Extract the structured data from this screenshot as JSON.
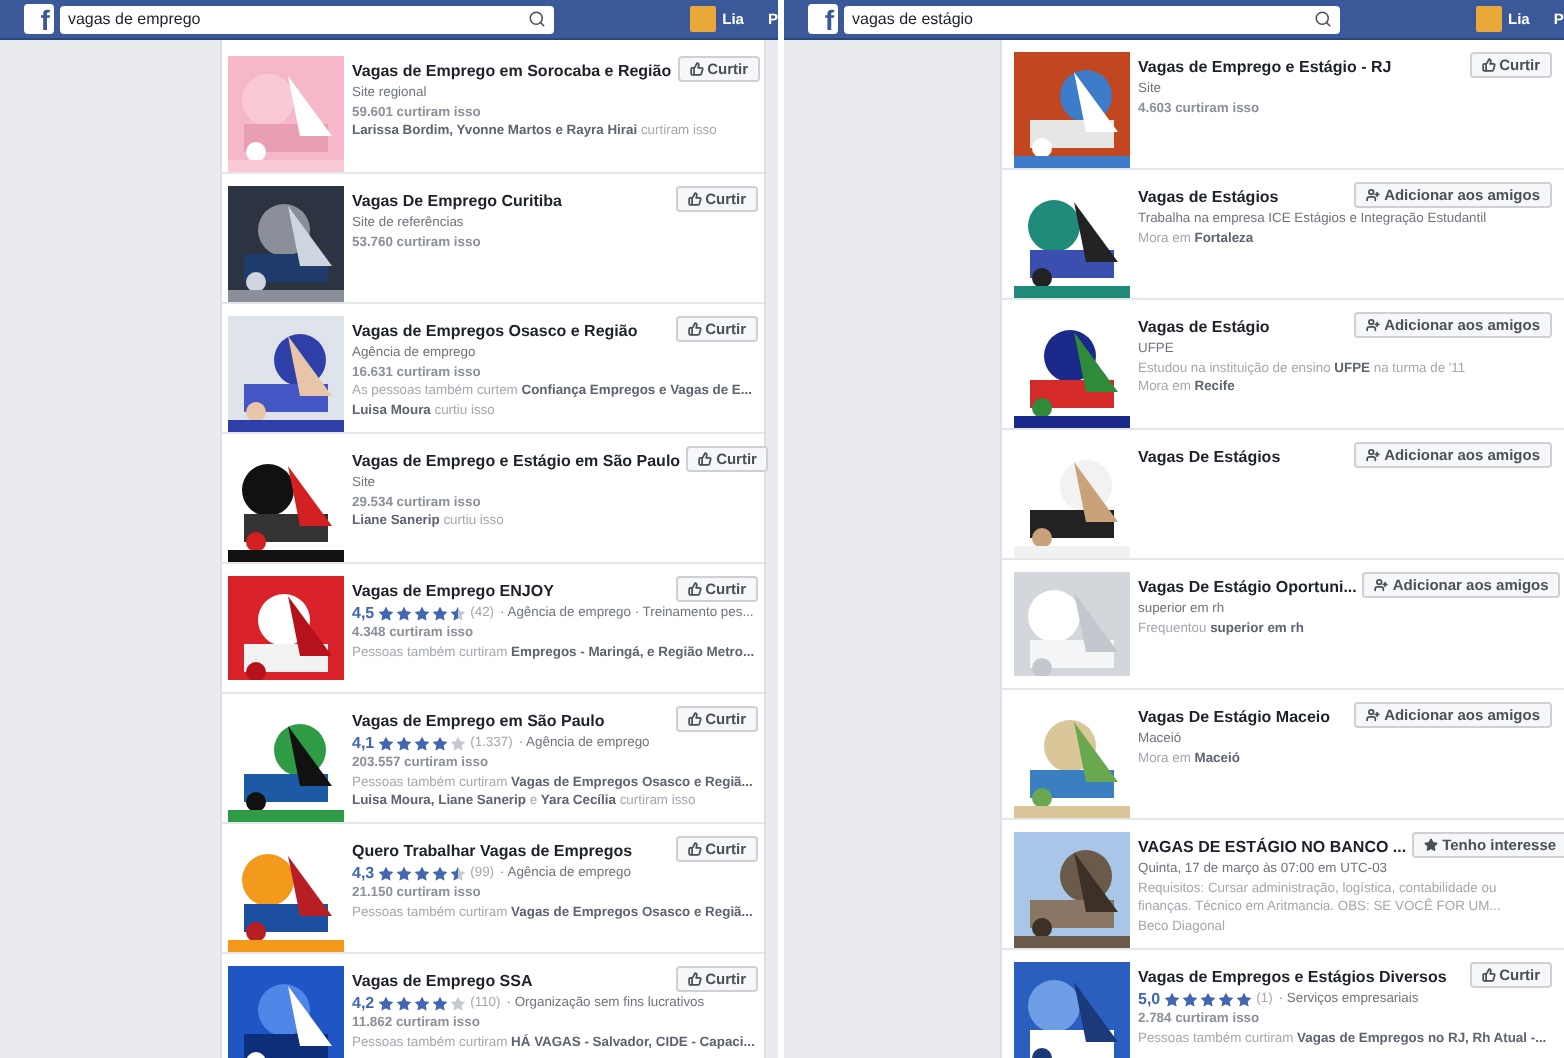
{
  "panels": [
    {
      "header": {
        "logo": "f",
        "search": {
          "value": "vagas de emprego"
        },
        "user": "Lia",
        "cut_label": "P"
      },
      "results": [
        {
          "title": "Vagas de Emprego em Sorocaba e Região",
          "button": {
            "kind": "like",
            "label": "Curtir"
          },
          "lines": [
            {
              "kind": "plain",
              "text": "Site regional"
            },
            {
              "kind": "count",
              "text": "59.601 curtiram isso"
            },
            {
              "kind": "muted",
              "text": "**Larissa Bordim, Yvonne Martos e Rayra Hirai** curtiram isso"
            }
          ]
        },
        {
          "title": "Vagas De Emprego Curitiba",
          "button": {
            "kind": "like",
            "label": "Curtir"
          },
          "lines": [
            {
              "kind": "plain",
              "text": "Site de referências"
            },
            {
              "kind": "count",
              "text": "53.760 curtiram isso"
            }
          ]
        },
        {
          "title": "Vagas de Empregos Osasco e Região",
          "button": {
            "kind": "like",
            "label": "Curtir"
          },
          "lines": [
            {
              "kind": "plain",
              "text": "Agência de emprego"
            },
            {
              "kind": "count",
              "text": "16.631 curtiram isso"
            },
            {
              "kind": "muted",
              "text": "As pessoas também curtem **Confiança Empregos e Vagas de E...**"
            },
            {
              "kind": "muted",
              "text": "**Luisa Moura** curtiu isso"
            }
          ]
        },
        {
          "title": "Vagas de Emprego e Estágio em São Paulo",
          "button": {
            "kind": "like",
            "label": "Curtir"
          },
          "lines": [
            {
              "kind": "plain",
              "text": "Site"
            },
            {
              "kind": "count",
              "text": "29.534 curtiram isso"
            },
            {
              "kind": "muted",
              "text": "**Liane Sanerip** curtiu isso"
            }
          ]
        },
        {
          "title": "Vagas de Emprego ENJOY",
          "button": {
            "kind": "like",
            "label": "Curtir"
          },
          "lines": [
            {
              "kind": "rating",
              "score": "4,5",
              "stars": 4.5,
              "count": "(42)",
              "text": "· Agência de emprego · Treinamento pes..."
            },
            {
              "kind": "count",
              "text": "4.348 curtiram isso"
            },
            {
              "kind": "muted",
              "text": "Pessoas também curtiram **Empregos - Maringá, e Região Metro...**"
            }
          ]
        },
        {
          "title": "Vagas de Emprego em São Paulo",
          "button": {
            "kind": "like",
            "label": "Curtir"
          },
          "lines": [
            {
              "kind": "rating",
              "score": "4,1",
              "stars": 4,
              "count": "(1.337)",
              "text": "· Agência de emprego"
            },
            {
              "kind": "count",
              "text": "203.557 curtiram isso"
            },
            {
              "kind": "muted",
              "text": "Pessoas também curtiram **Vagas de Empregos Osasco e Regiã...**"
            },
            {
              "kind": "muted",
              "text": "**Luisa Moura, Liane Sanerip** e **Yara Cecília** curtiram isso"
            }
          ]
        },
        {
          "title": "Quero Trabalhar Vagas de Empregos",
          "button": {
            "kind": "like",
            "label": "Curtir"
          },
          "lines": [
            {
              "kind": "rating",
              "score": "4,3",
              "stars": 4.5,
              "count": "(99)",
              "text": "· Agência de emprego"
            },
            {
              "kind": "count",
              "text": "21.150 curtiram isso"
            },
            {
              "kind": "muted",
              "text": "Pessoas também curtiram **Vagas de Empregos Osasco e Regiã...**"
            }
          ]
        },
        {
          "title": "Vagas de Emprego SSA",
          "button": {
            "kind": "like",
            "label": "Curtir"
          },
          "lines": [
            {
              "kind": "rating",
              "score": "4,2",
              "stars": 4,
              "count": "(110)",
              "text": "· Organização sem fins lucrativos"
            },
            {
              "kind": "count",
              "text": "11.862 curtiram isso"
            },
            {
              "kind": "muted",
              "text": "Pessoas também curtiram **HÁ VAGAS - Salvador, CIDE - Capaci...**"
            }
          ]
        }
      ]
    },
    {
      "header": {
        "logo": "f",
        "search": {
          "value": "vagas de estágio"
        },
        "user": "Lia",
        "cut_label": "P"
      },
      "results": [
        {
          "title": "Vagas de Emprego e Estágio - RJ",
          "button": {
            "kind": "like",
            "label": "Curtir"
          },
          "lines": [
            {
              "kind": "plain",
              "text": "Site"
            },
            {
              "kind": "count",
              "text": "4.603 curtiram isso"
            }
          ]
        },
        {
          "title": "Vagas de Estágios",
          "button": {
            "kind": "add_friend",
            "label": "Adicionar aos amigos"
          },
          "lines": [
            {
              "kind": "plain",
              "text": "Trabalha na empresa ICE Estágios e Integração Estudantil"
            },
            {
              "kind": "muted",
              "text": "Mora em **Fortaleza**"
            }
          ]
        },
        {
          "title": "Vagas de Estágio",
          "button": {
            "kind": "add_friend",
            "label": "Adicionar aos amigos"
          },
          "lines": [
            {
              "kind": "plain",
              "text": "UFPE"
            },
            {
              "kind": "muted",
              "text": "Estudou na instituição de ensino **UFPE** na turma de '11"
            },
            {
              "kind": "muted",
              "text": "Mora em **Recife**"
            }
          ]
        },
        {
          "title": "Vagas De Estágios",
          "button": {
            "kind": "add_friend",
            "label": "Adicionar aos amigos"
          }
        },
        {
          "title": "Vagas De Estágio Oportuni...",
          "button": {
            "kind": "add_friend",
            "label": "Adicionar aos amigos"
          },
          "lines": [
            {
              "kind": "plain",
              "text": "superior em rh"
            },
            {
              "kind": "muted",
              "text": "Frequentou **superior em rh**"
            }
          ]
        },
        {
          "title": "Vagas De Estágio Maceio",
          "button": {
            "kind": "add_friend",
            "label": "Adicionar aos amigos"
          },
          "lines": [
            {
              "kind": "plain",
              "text": "Maceió"
            },
            {
              "kind": "muted",
              "text": "Mora em **Maceió**"
            }
          ]
        },
        {
          "title": "VAGAS DE ESTÁGIO NO BANCO ...",
          "button": {
            "kind": "interest",
            "label": "Tenho interesse"
          },
          "lines": [
            {
              "kind": "plain",
              "text": "Quinta, 17 de março às 07:00 em UTC-03"
            },
            {
              "kind": "muted",
              "text": "Requisitos: Cursar administração, logística, contabilidade ou finanças. Técnico em Aritmancia. OBS: SE VOCÊ FOR UM..."
            },
            {
              "kind": "muted",
              "text": "Beco Diagonal"
            }
          ]
        },
        {
          "title": "Vagas de Empregos e Estágios Diversos",
          "button": {
            "kind": "like",
            "label": "Curtir"
          },
          "lines": [
            {
              "kind": "rating",
              "score": "5,0",
              "stars": 5,
              "count": "(1)",
              "text": "· Serviços empresariais"
            },
            {
              "kind": "count",
              "text": "2.784 curtiram isso"
            },
            {
              "kind": "muted",
              "text": "Pessoas também curtiram **Vagas de Empregos no RJ, Rh Atual -...**"
            }
          ]
        }
      ]
    }
  ]
}
